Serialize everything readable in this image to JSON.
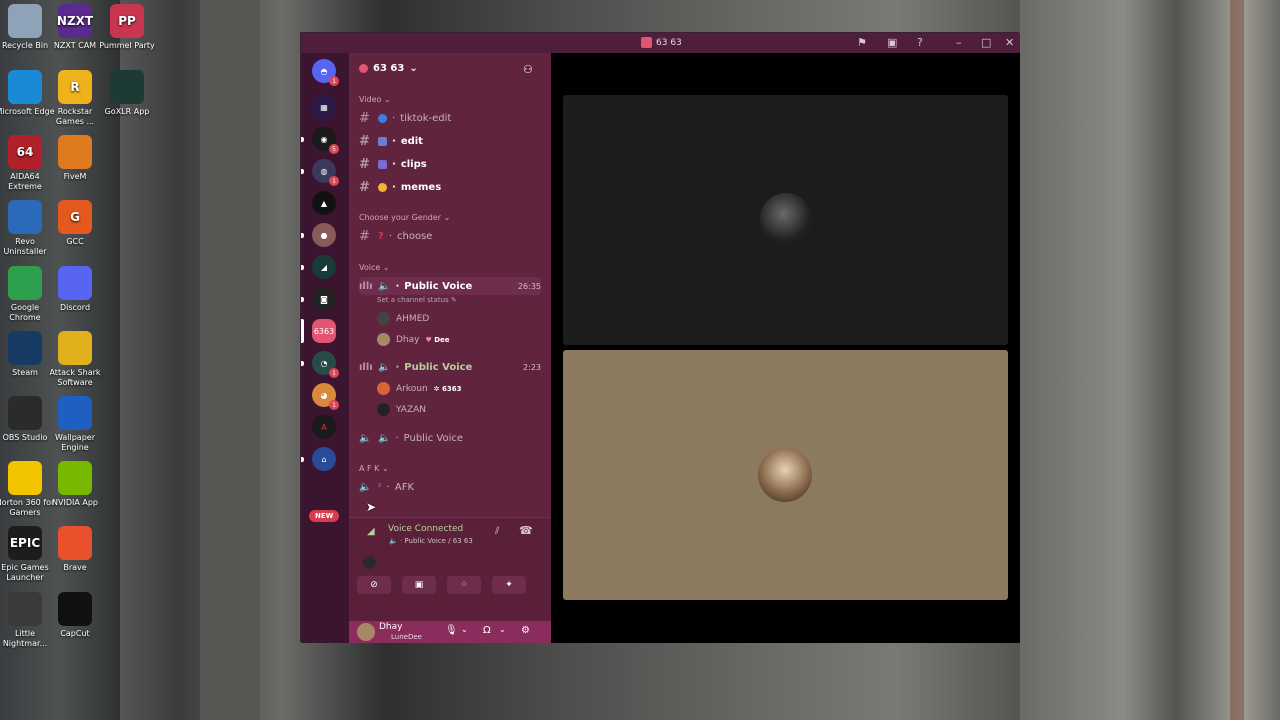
{
  "desktop_icons": [
    {
      "label": "Recycle Bin",
      "icon": "recycle-bin-icon",
      "color": "#8fa3b8"
    },
    {
      "label": "NZXT CAM",
      "icon": "nzxt-cam-icon",
      "color": "#5a2b8c",
      "glyph": "NZXT"
    },
    {
      "label": "Pummel Party",
      "icon": "pummel-party-icon",
      "color": "#c8354e",
      "glyph": "PP"
    },
    {
      "label": "Microsoft Edge",
      "icon": "edge-icon",
      "color": "#1b8ad6"
    },
    {
      "label": "Rockstar Games ...",
      "icon": "rockstar-icon",
      "color": "#f0b21a",
      "glyph": "R"
    },
    {
      "label": "GoXLR App",
      "icon": "goxlr-icon",
      "color": "#1d3a34"
    },
    {
      "label": "AIDA64 Extreme",
      "icon": "aida64-icon",
      "color": "#b0212a",
      "glyph": "64"
    },
    {
      "label": "FiveM",
      "icon": "fivem-icon",
      "color": "#e07a1f"
    },
    {
      "label": "Revo Uninstaller",
      "icon": "revo-icon",
      "color": "#2a6ab8"
    },
    {
      "label": "GCC",
      "icon": "gcc-icon",
      "color": "#e5581e",
      "glyph": "G"
    },
    {
      "label": "Google Chrome",
      "icon": "chrome-icon",
      "color": "#2e9f4d"
    },
    {
      "label": "Discord",
      "icon": "discord-icon",
      "color": "#5865f2"
    },
    {
      "label": "Steam",
      "icon": "steam-icon",
      "color": "#173b62"
    },
    {
      "label": "Attack Shark Software",
      "icon": "attack-shark-icon",
      "color": "#e0b11c"
    },
    {
      "label": "OBS Studio",
      "icon": "obs-icon",
      "color": "#2b2b2b"
    },
    {
      "label": "Wallpaper Engine",
      "icon": "wallpaper-engine-icon",
      "color": "#1f5fc2"
    },
    {
      "label": "Norton 360 for Gamers",
      "icon": "norton-icon",
      "color": "#f2c400"
    },
    {
      "label": "NVIDIA App",
      "icon": "nvidia-icon",
      "color": "#76b900"
    },
    {
      "label": "Epic Games Launcher",
      "icon": "epic-icon",
      "color": "#1d1d1d",
      "glyph": "EPIC"
    },
    {
      "label": "Brave",
      "icon": "brave-icon",
      "color": "#e8512c"
    },
    {
      "label": "Little Nightmar...",
      "icon": "little-nightmares-icon",
      "color": "#3a3a3a"
    },
    {
      "label": "CapCut",
      "icon": "capcut-icon",
      "color": "#111111"
    }
  ],
  "window": {
    "title": "63 63"
  },
  "server_header": {
    "name": "63 63",
    "chevron": "chevron-down-icon"
  },
  "categories": {
    "video": "Video",
    "gender": "Choose your Gender",
    "voice": "Voice",
    "afk": "A F K"
  },
  "text_channels": [
    {
      "name": "tiktok-edit",
      "emoji_color": "#3b7de0",
      "bright": false
    },
    {
      "name": "edit",
      "emoji_color": "#6c7bd8",
      "bright": true
    },
    {
      "name": "clips",
      "emoji_color": "#7a6bd0",
      "bright": true
    },
    {
      "name": "memes",
      "emoji_color": "#f2b23a",
      "bright": true
    },
    {
      "name": "choose",
      "emoji_color": "#e0304a",
      "glyph": "?",
      "bright": false
    }
  ],
  "voice_channels": [
    {
      "name": "Public Voice",
      "time": "26:35",
      "status": "Set a channel status",
      "members": [
        {
          "name": "AHMED",
          "tag": "",
          "color": "#444444"
        },
        {
          "name": "Dhay",
          "tag": "Dee",
          "tag_icon": "♥",
          "color": "#a88966"
        }
      ]
    },
    {
      "name": "Public Voice",
      "time": "2:23",
      "members": [
        {
          "name": "Arkoun",
          "tag": "6363",
          "tag_icon": "✲",
          "color": "#d9643a"
        },
        {
          "name": "YAZAN",
          "tag": "",
          "color": "#222222"
        }
      ]
    },
    {
      "name": "Public Voice",
      "time": "",
      "members": []
    },
    {
      "name": "AFK",
      "time": "",
      "members": []
    }
  ],
  "voice_panel": {
    "title": "Voice Connected",
    "subtitle": "Public Voice / 63 63"
  },
  "user": {
    "name": "Dhay",
    "status": "LuneDee"
  },
  "server_list": {
    "new_badge": "NEW",
    "badges": [
      "1",
      "5",
      "1",
      "1",
      "1"
    ],
    "server_label": "6363"
  },
  "colors": {
    "titlebar": "#4e1e3c",
    "sidebar": "#61243f",
    "accent_green": "#b7cf9c",
    "tile_top": "#1c1c1c",
    "tile_bottom": "#8c7a5e"
  }
}
